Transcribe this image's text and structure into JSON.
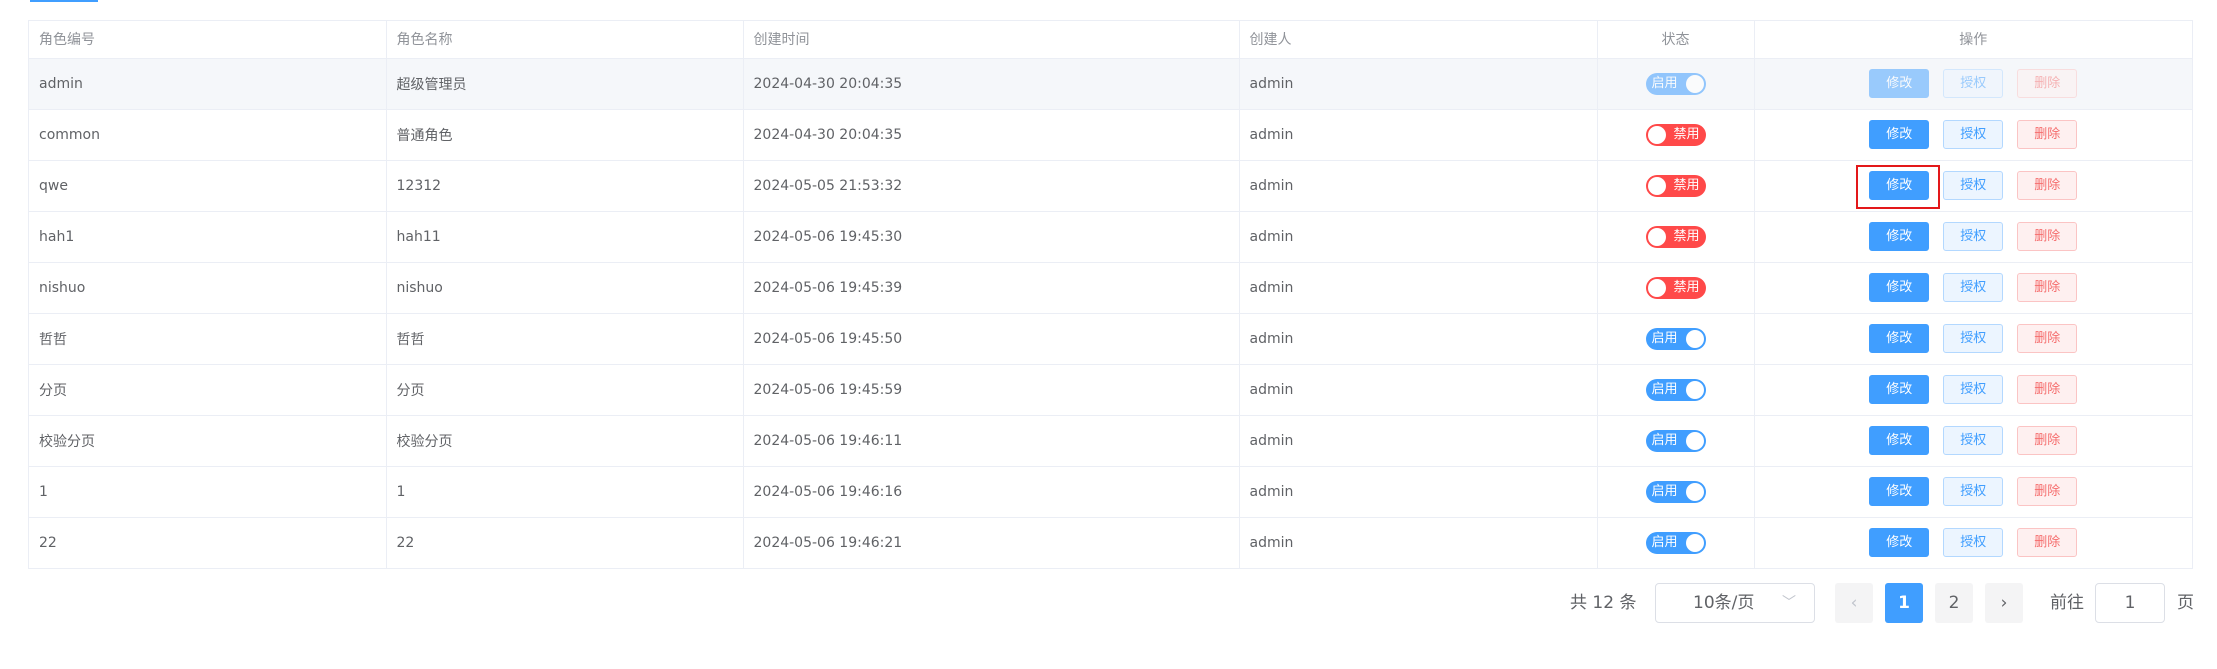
{
  "columns": {
    "code": "角色编号",
    "name": "角色名称",
    "created_at": "创建时间",
    "creator": "创建人",
    "status": "状态",
    "actions": "操作"
  },
  "rows": [
    {
      "code": "admin",
      "name": "超级管理员",
      "created_at": "2024-04-30 20:04:35",
      "creator": "admin",
      "status": "启用",
      "enabled": true,
      "disabled_actions": true
    },
    {
      "code": "common",
      "name": "普通角色",
      "created_at": "2024-04-30 20:04:35",
      "creator": "admin",
      "status": "禁用",
      "enabled": false,
      "disabled_actions": false
    },
    {
      "code": "qwe",
      "name": "12312",
      "created_at": "2024-05-05 21:53:32",
      "creator": "admin",
      "status": "禁用",
      "enabled": false,
      "disabled_actions": false,
      "highlighted_edit": true
    },
    {
      "code": "hah1",
      "name": "hah11",
      "created_at": "2024-05-06 19:45:30",
      "creator": "admin",
      "status": "禁用",
      "enabled": false,
      "disabled_actions": false
    },
    {
      "code": "nishuo",
      "name": "nishuo",
      "created_at": "2024-05-06 19:45:39",
      "creator": "admin",
      "status": "禁用",
      "enabled": false,
      "disabled_actions": false
    },
    {
      "code": "哲哲",
      "name": "哲哲",
      "created_at": "2024-05-06 19:45:50",
      "creator": "admin",
      "status": "启用",
      "enabled": true,
      "disabled_actions": false
    },
    {
      "code": "分页",
      "name": "分页",
      "created_at": "2024-05-06 19:45:59",
      "creator": "admin",
      "status": "启用",
      "enabled": true,
      "disabled_actions": false
    },
    {
      "code": "校验分页",
      "name": "校验分页",
      "created_at": "2024-05-06 19:46:11",
      "creator": "admin",
      "status": "启用",
      "enabled": true,
      "disabled_actions": false
    },
    {
      "code": "1",
      "name": "1",
      "created_at": "2024-05-06 19:46:16",
      "creator": "admin",
      "status": "启用",
      "enabled": true,
      "disabled_actions": false
    },
    {
      "code": "22",
      "name": "22",
      "created_at": "2024-05-06 19:46:21",
      "creator": "admin",
      "status": "启用",
      "enabled": true,
      "disabled_actions": false
    }
  ],
  "actions": {
    "edit": "修改",
    "auth": "授权",
    "delete": "删除"
  },
  "pagination": {
    "total": "共 12 条",
    "page_size": "10条/页",
    "pages": [
      "1",
      "2"
    ],
    "current_page": "1",
    "goto_label": "前往",
    "goto_value": "1",
    "page_suffix": "页",
    "prev_icon": "chevron-left-icon",
    "next_icon": "chevron-right-icon"
  },
  "colors": {
    "primary": "#409eff",
    "danger": "#ff4949",
    "highlight": "#e3181a"
  }
}
